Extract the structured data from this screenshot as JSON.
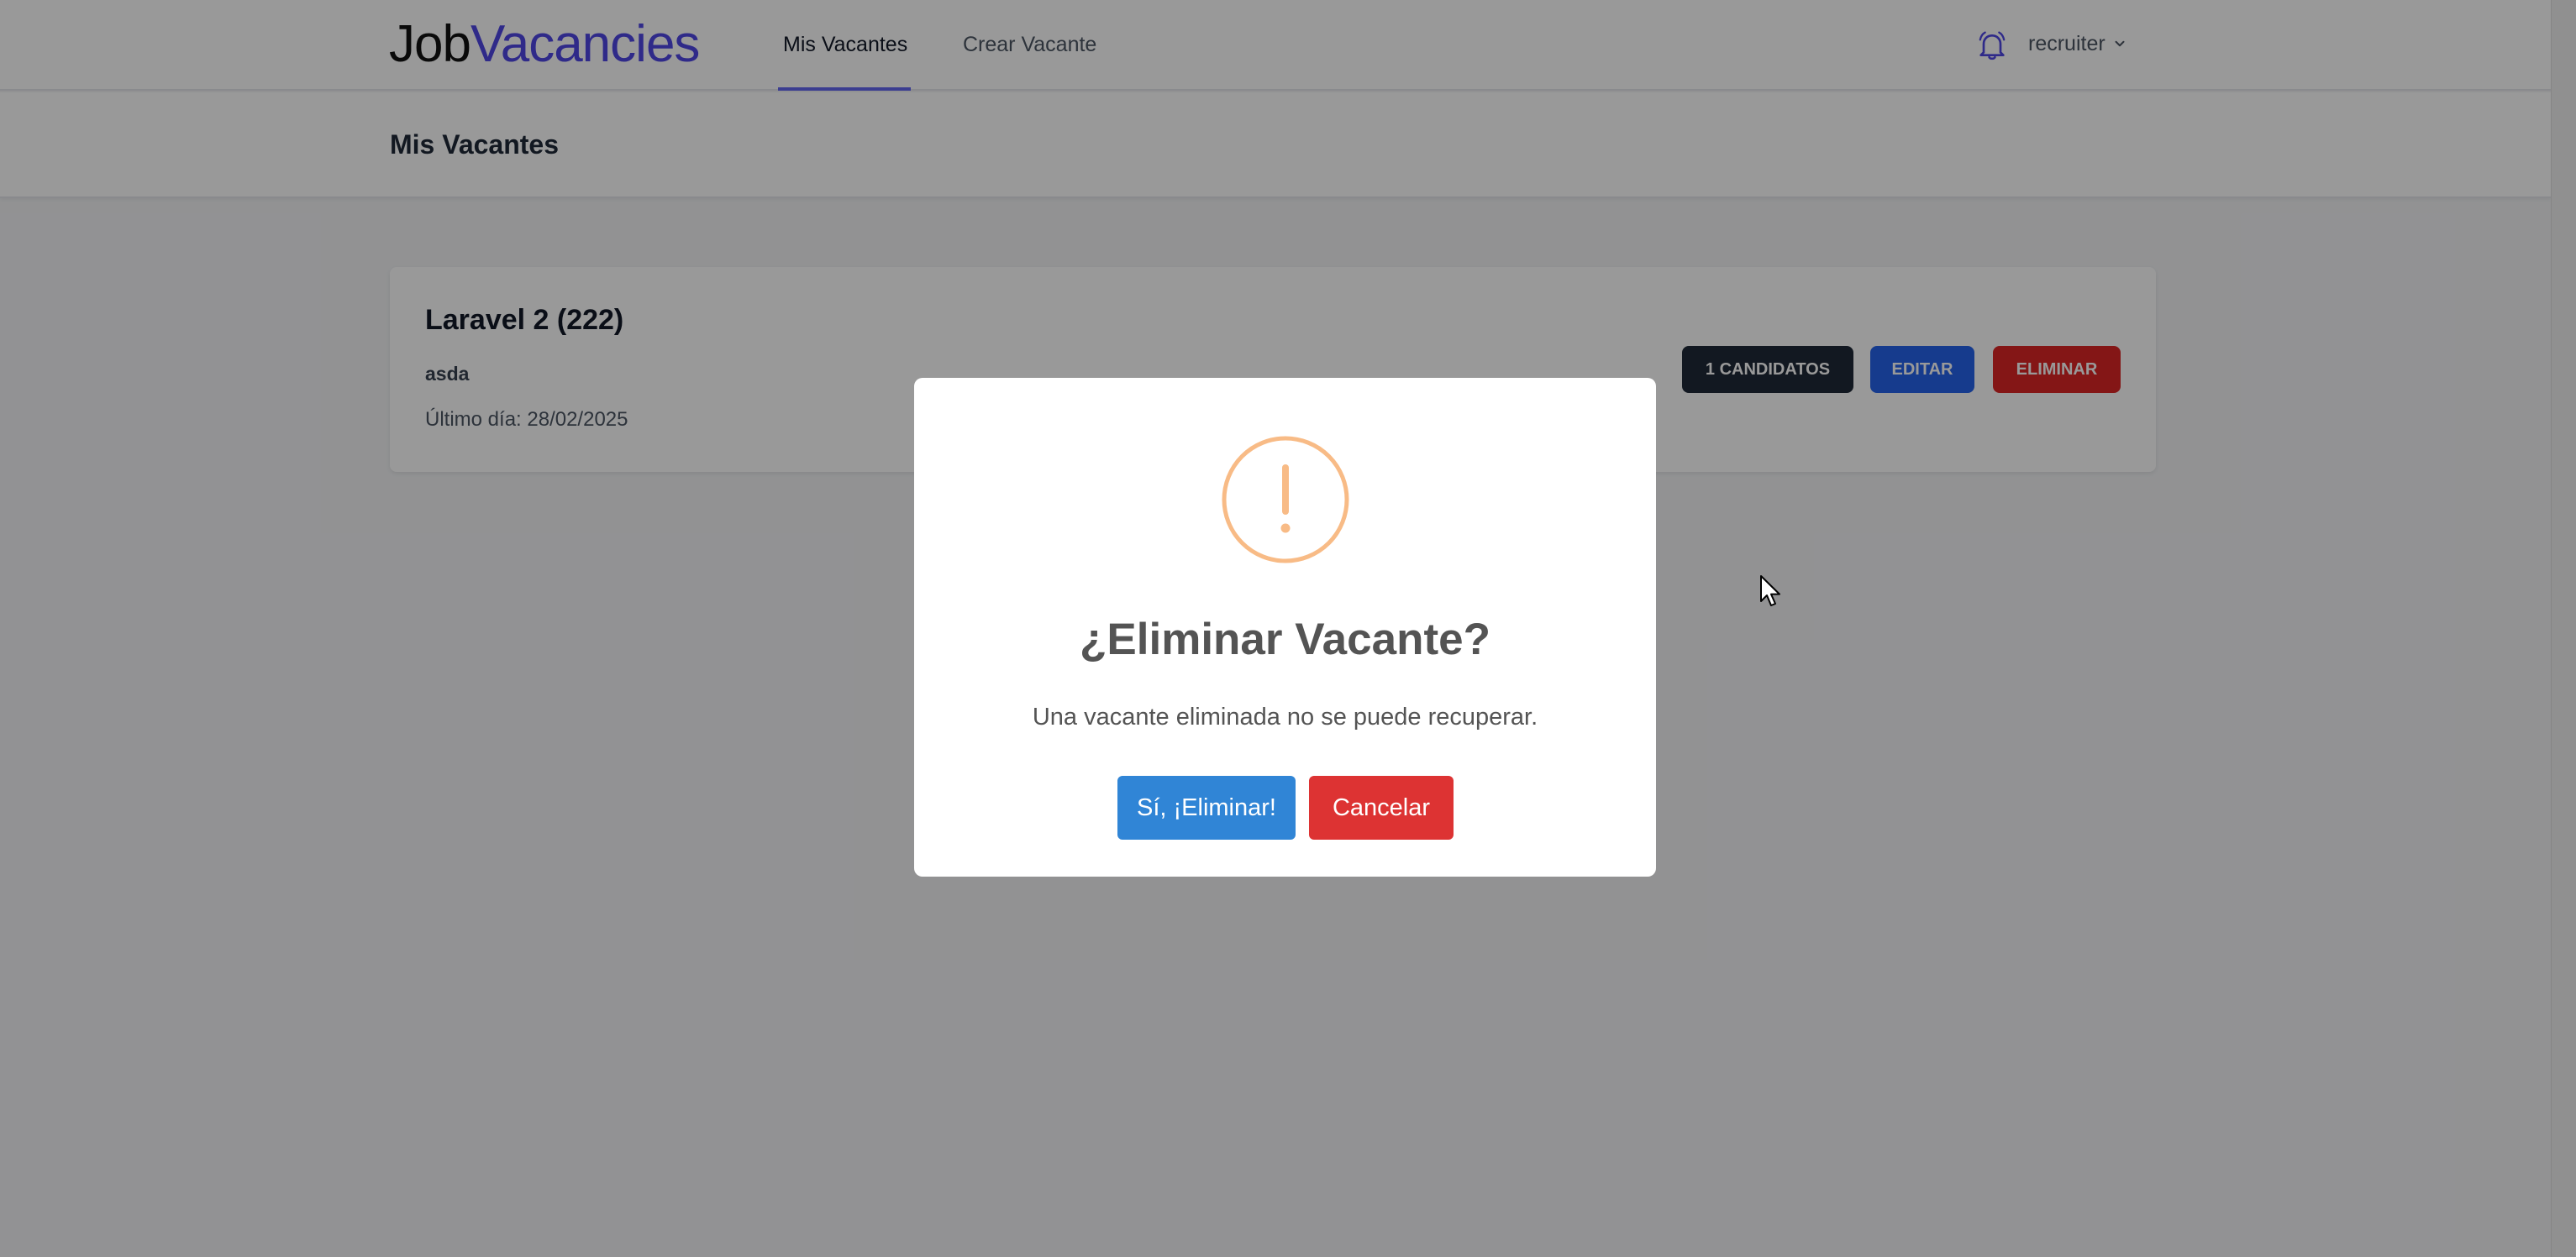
{
  "navbar": {
    "logo_part1": "Job",
    "logo_part2": "Vacancies",
    "links": [
      {
        "label": "Mis Vacantes"
      },
      {
        "label": "Crear Vacante"
      }
    ],
    "user": "recruiter"
  },
  "header": {
    "title": "Mis Vacantes"
  },
  "vacancy": {
    "title": "Laravel 2 (222)",
    "company": "asda",
    "last_day": "Último día: 28/02/2025",
    "candidates_label": "1 Candidatos",
    "edit_label": "Editar",
    "delete_label": "Eliminar"
  },
  "modal": {
    "title": "¿Eliminar Vacante?",
    "text": "Una vacante eliminada no se puede recuperar.",
    "confirm_label": "Sí, ¡Eliminar!",
    "cancel_label": "Cancelar"
  },
  "colors": {
    "accent": "#4f46e5",
    "confirm": "#3085d6",
    "cancel": "#dd3333",
    "warning": "#f8bb86"
  },
  "icons": {
    "notifications": "bell-icon",
    "user_dropdown": "chevron-down-icon",
    "modal": "warning-icon"
  }
}
